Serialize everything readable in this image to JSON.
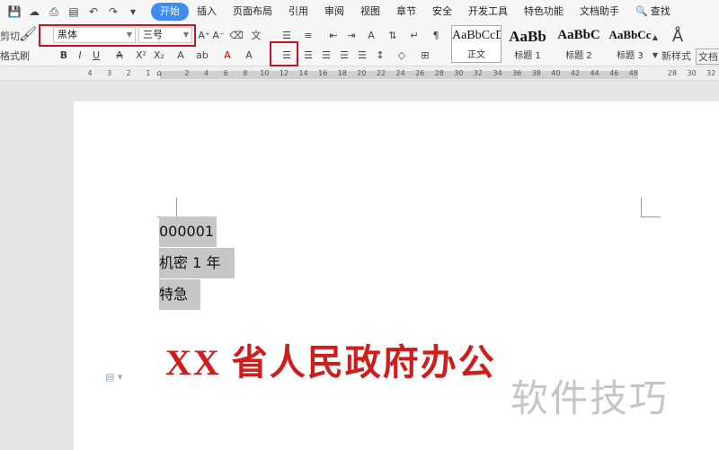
{
  "menubar": {
    "tabs": [
      {
        "label": "开始",
        "active": true
      },
      {
        "label": "插入"
      },
      {
        "label": "页面布局"
      },
      {
        "label": "引用"
      },
      {
        "label": "审阅"
      },
      {
        "label": "视图"
      },
      {
        "label": "章节"
      },
      {
        "label": "安全"
      },
      {
        "label": "开发工具"
      },
      {
        "label": "特色功能"
      },
      {
        "label": "文档助手"
      },
      {
        "label": "查找"
      }
    ]
  },
  "ribbon": {
    "cut_label": "剪切",
    "format_painter_label": "格式刷",
    "font_name": "黑体",
    "font_size": "三号",
    "styles": [
      {
        "preview": "AaBbCcD",
        "name": "正文"
      },
      {
        "preview": "AaBb",
        "name": "标题 1"
      },
      {
        "preview": "AaBbC",
        "name": "标题 2"
      },
      {
        "preview": "AaBbCc",
        "name": "标题 3"
      }
    ],
    "new_style_label": "新样式",
    "doc_label": "文档"
  },
  "ruler": {
    "ticks": [
      "4",
      "3",
      "2",
      "1",
      "",
      "2",
      "4",
      "6",
      "8",
      "10",
      "12",
      "14",
      "16",
      "18",
      "20",
      "22",
      "24",
      "26",
      "28",
      "30",
      "32",
      "34",
      "36",
      "38",
      "40",
      "42",
      "44",
      "46",
      "48",
      "",
      "28",
      "30",
      "32"
    ]
  },
  "document": {
    "lines": [
      "000001",
      "机密 1 年",
      "特急"
    ],
    "red_header": "XX 省人民政府办公",
    "watermark": "软件技巧"
  },
  "colors": {
    "accent": "#3f8bf2",
    "highlight_box": "#c0171c",
    "red_header": "#cf1d1d",
    "selection": "#c6c6c6"
  }
}
